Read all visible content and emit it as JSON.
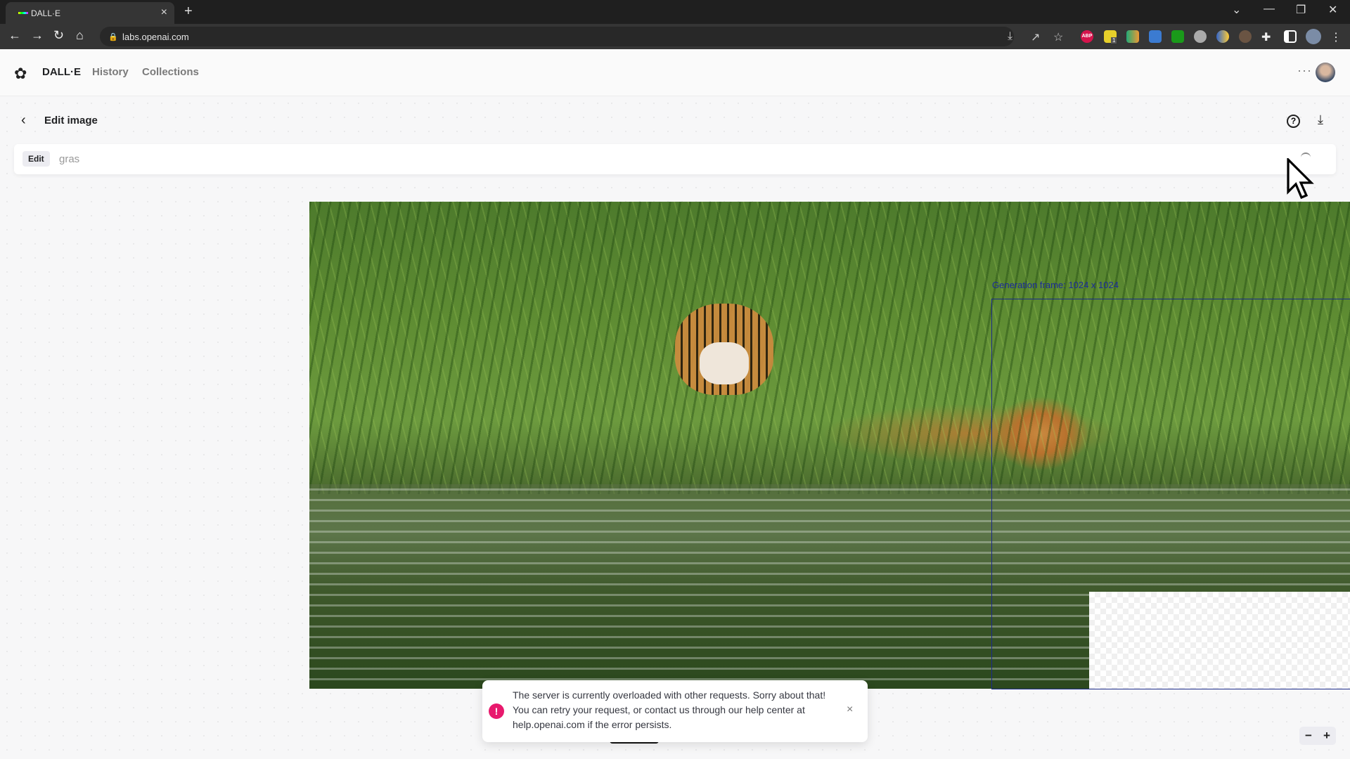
{
  "browser": {
    "tab_title": "DALL·E",
    "url": "labs.openai.com"
  },
  "header": {
    "brand": "DALL·E",
    "nav": [
      {
        "label": "History"
      },
      {
        "label": "Collections"
      }
    ],
    "more_icon": "ellipsis-icon"
  },
  "page": {
    "title": "Edit image"
  },
  "prompt": {
    "badge": "Edit",
    "value": "gras"
  },
  "canvas": {
    "frame_label": "Generation frame: 1024 x 1024",
    "zoom_out": "−",
    "zoom_in": "+"
  },
  "toast": {
    "message": "The server is currently overloaded with other requests. Sorry about that! You can retry your request, or contact us through our help center at help.openai.com if the error persists.",
    "close": "×",
    "icon": "!",
    "error_color": "#e8196d"
  },
  "extensions": {
    "badge_count": "1",
    "abp": "ABP"
  }
}
